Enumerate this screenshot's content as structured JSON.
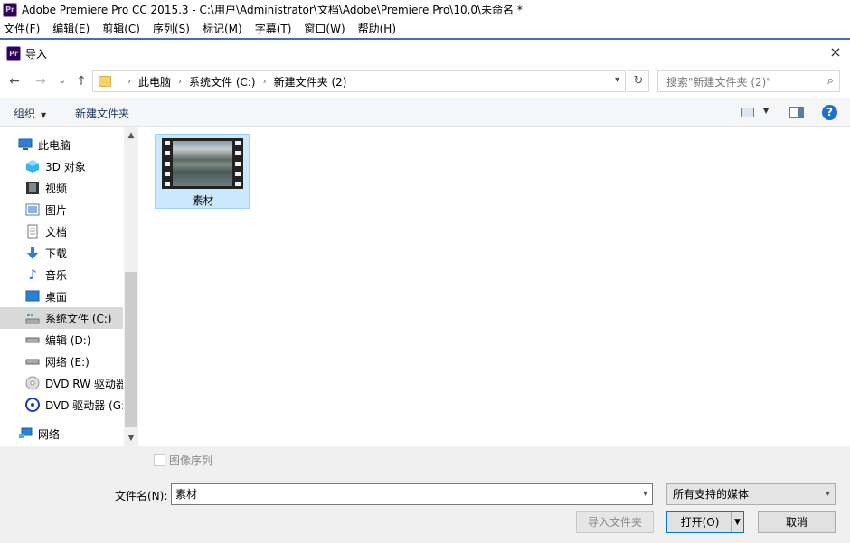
{
  "app": {
    "title": "Adobe Premiere Pro CC 2015.3 - C:\\用户\\Administrator\\文档\\Adobe\\Premiere Pro\\10.0\\未命名 *",
    "logo": "Pr",
    "menu": [
      "文件(F)",
      "编辑(E)",
      "剪辑(C)",
      "序列(S)",
      "标记(M)",
      "字幕(T)",
      "窗口(W)",
      "帮助(H)"
    ]
  },
  "dialog": {
    "logo": "Pr",
    "title": "导入",
    "close_icon": "×"
  },
  "nav": {
    "back": "←",
    "forward": "→",
    "recent": "⌄",
    "up": "↑",
    "breadcrumbs": [
      "此电脑",
      "系统文件 (C:)",
      "新建文件夹 (2)"
    ],
    "refresh": "↻",
    "search_placeholder": "搜索\"新建文件夹 (2)\"",
    "search_icon": "⌕"
  },
  "toolbar": {
    "organize_label": "组织",
    "new_folder_label": "新建文件夹",
    "help": "?"
  },
  "sidebar": {
    "items": [
      {
        "label": "此电脑",
        "icon": "pc-icon"
      },
      {
        "label": "3D 对象",
        "icon": "cube-icon"
      },
      {
        "label": "视频",
        "icon": "video-icon"
      },
      {
        "label": "图片",
        "icon": "picture-icon"
      },
      {
        "label": "文档",
        "icon": "document-icon"
      },
      {
        "label": "下载",
        "icon": "download-icon"
      },
      {
        "label": "音乐",
        "icon": "music-icon"
      },
      {
        "label": "桌面",
        "icon": "desktop-icon"
      },
      {
        "label": "系统文件 (C:)",
        "icon": "system-drive-icon",
        "selected": true
      },
      {
        "label": "编辑 (D:)",
        "icon": "drive-icon"
      },
      {
        "label": "网络 (E:)",
        "icon": "drive-icon"
      },
      {
        "label": "DVD RW 驱动器",
        "icon": "dvd-rw-icon"
      },
      {
        "label": "DVD 驱动器 (G:",
        "icon": "dvd-icon"
      },
      {
        "label": "网络",
        "icon": "network-icon"
      }
    ]
  },
  "files": [
    {
      "name": "素材",
      "type": "video"
    }
  ],
  "bottom": {
    "image_sequence_label": "图像序列",
    "filename_label": "文件名(N):",
    "filename_value": "素材",
    "file_type_value": "所有支持的媒体",
    "import_folder_label": "导入文件夹",
    "open_label": "打开(O)",
    "cancel_label": "取消"
  }
}
